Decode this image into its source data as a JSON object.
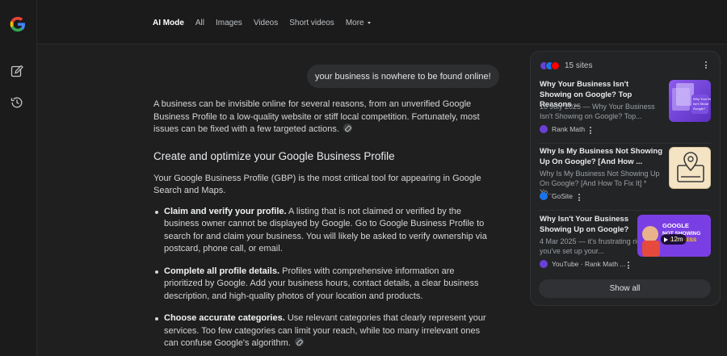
{
  "nav": {
    "tabs": [
      {
        "label": "AI Mode",
        "active": true
      },
      {
        "label": "All",
        "active": false
      },
      {
        "label": "Images",
        "active": false
      },
      {
        "label": "Videos",
        "active": false
      },
      {
        "label": "Short videos",
        "active": false
      },
      {
        "label": "More",
        "active": false
      }
    ]
  },
  "sidebar": {
    "icons": [
      "google-logo",
      "new-chat-icon",
      "history-icon"
    ]
  },
  "chat": {
    "user_query": "your business is nowhere to be found online!"
  },
  "answer": {
    "intro": "A business can be invisible online for several reasons, from an unverified Google Business Profile to a low-quality website or stiff local competition. Fortunately, most issues can be fixed with a few targeted actions.",
    "heading": "Create and optimize your Google Business Profile",
    "section_intro": "Your Google Business Profile (GBP) is the most critical tool for appearing in Google Search and Maps.",
    "bullets": [
      {
        "bold": "Claim and verify your profile.",
        "text": " A listing that is not claimed or verified by the business owner cannot be displayed by Google. Go to Google Business Profile to search for and claim your business. You will likely be asked to verify ownership via postcard, phone call, or email."
      },
      {
        "bold": "Complete all profile details.",
        "text": " Profiles with comprehensive information are prioritized by Google. Add your business hours, contact details, a clear business description, and high-quality photos of your location and products."
      },
      {
        "bold": "Choose accurate categories.",
        "text": " Use relevant categories that clearly represent your services. Too few categories can limit your reach, while too many irrelevant ones can confuse Google's algorithm."
      }
    ]
  },
  "sources": {
    "count_label": "15 sites",
    "show_all_label": "Show all",
    "items": [
      {
        "title": "Why Your Business Isn't Showing on Google? Top Reasons ...",
        "snippet": "16 July 2025 — Why Your Business Isn't Showing on Google? Top...",
        "site": "Rank Math",
        "thumb_text": "Why Your Bus Isn't Showi Google?"
      },
      {
        "title": "Why Is My Business Not Showing Up On Google? [And How ...",
        "snippet": "Why Is My Business Not Showing Up On Google? [And How To Fix It] * Yo...",
        "site": "GoSite"
      },
      {
        "title": "Why Isn't Your Business Showing Up on Google?",
        "snippet": "4 Mar 2025 — it's frustrating right you've set up your...",
        "site": "YouTube · Rank Math ...",
        "thumb_text": "GOOGLE NOT SHOWING BUSINESS",
        "duration": "12m"
      }
    ]
  },
  "colors": {
    "background": "#1f1f1f",
    "panel": "#232425",
    "rankmath_purple": "#6b3fd6",
    "gosite_blue": "#1a73e8",
    "youtube_red": "#ff0000"
  }
}
